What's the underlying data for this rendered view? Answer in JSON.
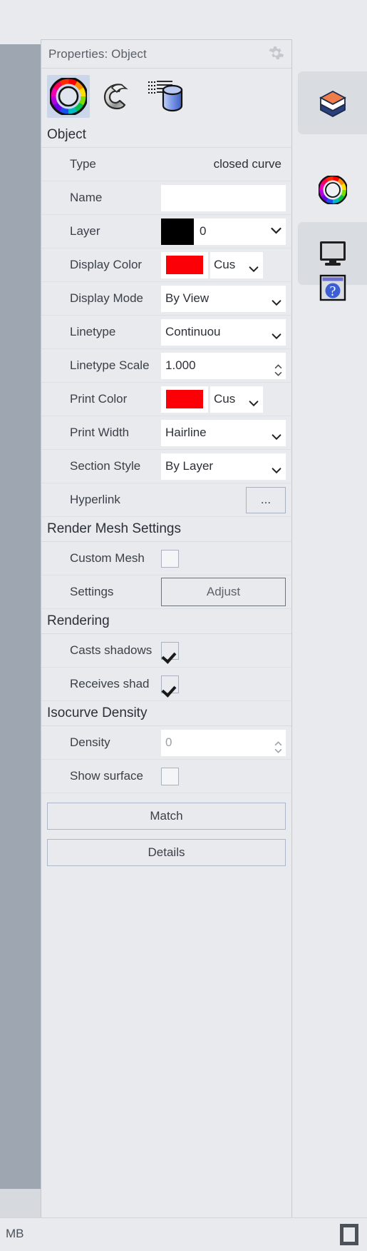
{
  "panel": {
    "title": "Properties: Object",
    "gear_icon": "gear-icon",
    "tools": [
      {
        "name": "object-properties-icon",
        "label": "Object"
      },
      {
        "name": "material-properties-icon",
        "label": "Material"
      },
      {
        "name": "texture-mapping-icon",
        "label": "Texture Mapping"
      }
    ]
  },
  "sections": {
    "object": "Object",
    "render_mesh": "Render Mesh Settings",
    "rendering": "Rendering",
    "isocurve": "Isocurve Density"
  },
  "object": {
    "type_label": "Type",
    "type_value": "closed curve",
    "name_label": "Name",
    "name_value": "",
    "layer_label": "Layer",
    "layer_value": "0",
    "layer_swatch": "#000000",
    "display_color_label": "Display Color",
    "display_color_swatch": "#fb0006",
    "display_color_mode": "Cus",
    "display_mode_label": "Display Mode",
    "display_mode_value": "By View",
    "linetype_label": "Linetype",
    "linetype_value": "Continuou",
    "linetype_scale_label": "Linetype Scale",
    "linetype_scale_value": "1.000",
    "print_color_label": "Print Color",
    "print_color_swatch": "#fb0006",
    "print_color_mode": "Cus",
    "print_width_label": "Print Width",
    "print_width_value": "Hairline",
    "section_style_label": "Section Style",
    "section_style_value": "By Layer",
    "hyperlink_label": "Hyperlink",
    "hyperlink_button": "..."
  },
  "render_mesh": {
    "custom_mesh_label": "Custom Mesh",
    "custom_mesh_checked": false,
    "settings_label": "Settings",
    "adjust_button": "Adjust"
  },
  "rendering": {
    "casts_shadows_label": "Casts shadows",
    "casts_shadows_checked": true,
    "receives_shadows_label": "Receives shad",
    "receives_shadows_checked": true
  },
  "isocurve": {
    "density_label": "Density",
    "density_value": "0",
    "show_surface_label": "Show surface",
    "show_surface_checked": false
  },
  "buttons": {
    "match": "Match",
    "details": "Details"
  },
  "rail": {
    "items": [
      {
        "name": "layers-icon",
        "label": "Layers"
      },
      {
        "name": "color-wheel-icon",
        "label": "Display"
      },
      {
        "name": "monitor-icon",
        "label": "Display Options"
      },
      {
        "name": "help-icon",
        "label": "Help"
      }
    ]
  },
  "status": {
    "text": "MB",
    "square_icon": "panel-toggle-icon"
  },
  "colors": {
    "panel_bg": "#e8eaed",
    "field_bg": "#ffffff",
    "selection": "#ccd6ea",
    "accent_red": "#fb0006",
    "viewport_grey": "#9ea7b1"
  }
}
